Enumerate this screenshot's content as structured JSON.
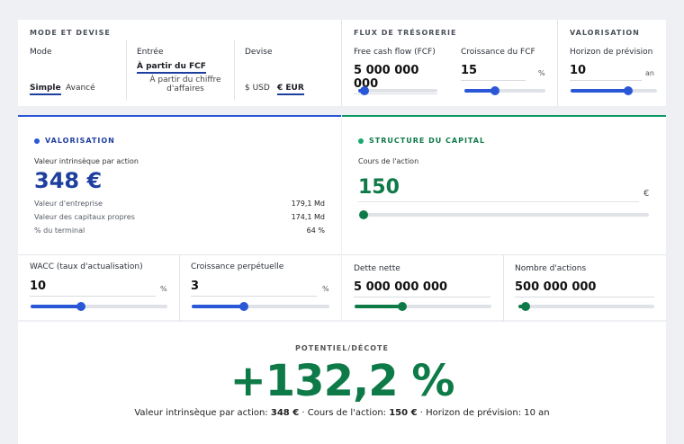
{
  "mode_devise": {
    "title": "MODE ET DEVISE",
    "mode_label": "Mode",
    "mode_simple": "Simple",
    "mode_avance": "Avancé",
    "entree_label": "Entrée",
    "entree_fcf": "À partir du FCF",
    "entree_ca_line1": "À partir du chiffre",
    "entree_ca_line2": "d'affaires",
    "devise_label": "Devise",
    "devise_usd": "$ USD",
    "devise_eur": "€ EUR"
  },
  "flux": {
    "title": "FLUX DE TRÉSORERIE",
    "fcf_label": "Free cash flow (FCF)",
    "fcf_value": "5 000 000 000",
    "fcf_slider": 0.08,
    "croissance_label": "Croissance du FCF",
    "croissance_value": "15",
    "croissance_unit": "%",
    "croissance_slider": 0.38
  },
  "valorisation_top": {
    "title": "VALORISATION",
    "horizon_label": "Horizon de prévision",
    "horizon_value": "10",
    "horizon_unit": "an",
    "horizon_slider": 0.67
  },
  "valorisation": {
    "title": "VALORISATION",
    "intrinsic_label": "Valeur intrinsèque par action",
    "intrinsic_value": "348 €",
    "rows": [
      {
        "label": "Valeur d'entreprise",
        "value": "179,1 Md"
      },
      {
        "label": "Valeur des capitaux propres",
        "value": "174,1 Md"
      },
      {
        "label": "% du terminal",
        "value": "64 %"
      }
    ],
    "wacc_label": "WACC (taux d'actualisation)",
    "wacc_value": "10",
    "wacc_unit": "%",
    "wacc_slider": 0.37,
    "perp_label": "Croissance perpétuelle",
    "perp_value": "3",
    "perp_unit": "%",
    "perp_slider": 0.38
  },
  "structure": {
    "title": "STRUCTURE DU CAPITAL",
    "cours_label": "Cours de l'action",
    "cours_value": "150",
    "cours_unit": "€",
    "cours_slider": 0.01,
    "dette_label": "Dette nette",
    "dette_value": "5 000 000 000",
    "dette_slider": 0.35,
    "nb_label": "Nombre d'actions",
    "nb_value": "500 000 000",
    "nb_slider": 0.05
  },
  "potentiel": {
    "title": "POTENTIEL/DÉCOTE",
    "value": "+132,2 %",
    "summary_intrinsic_label": "Valeur intrinsèque par action:",
    "summary_intrinsic_value": "348 €",
    "summary_cours_label": "Cours de l'action:",
    "summary_cours_value": "150 €",
    "summary_horizon": "Horizon de prévision: 10 an"
  },
  "colors": {
    "accent_blue": "#2a57d6",
    "accent_green": "#0e7a48",
    "dark_blue": "#1f3f9e"
  }
}
